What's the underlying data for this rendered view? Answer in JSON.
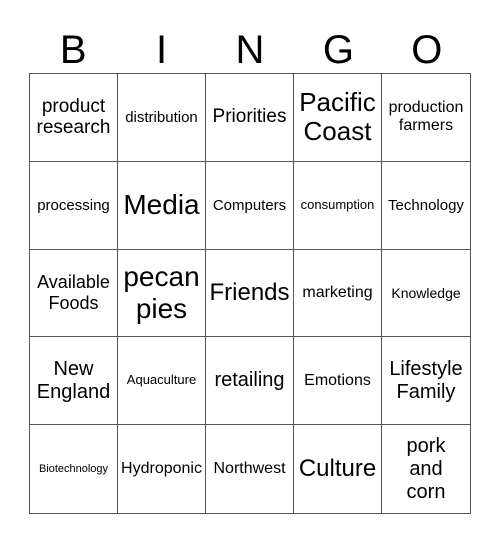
{
  "header": [
    "B",
    "I",
    "N",
    "G",
    "O"
  ],
  "cells": [
    [
      "product research",
      "distribution",
      "Priorities",
      "Pacific Coast",
      "production farmers"
    ],
    [
      "processing",
      "Media",
      "Computers",
      "consumption",
      "Technology"
    ],
    [
      "Available Foods",
      "pecan pies",
      "Friends",
      "marketing",
      "Knowledge"
    ],
    [
      "New England",
      "Aquaculture",
      "retailing",
      "Emotions",
      "Lifestyle Family"
    ],
    [
      "Biotechnology",
      "Hydroponic",
      "Northwest",
      "Culture",
      "pork and corn"
    ]
  ]
}
